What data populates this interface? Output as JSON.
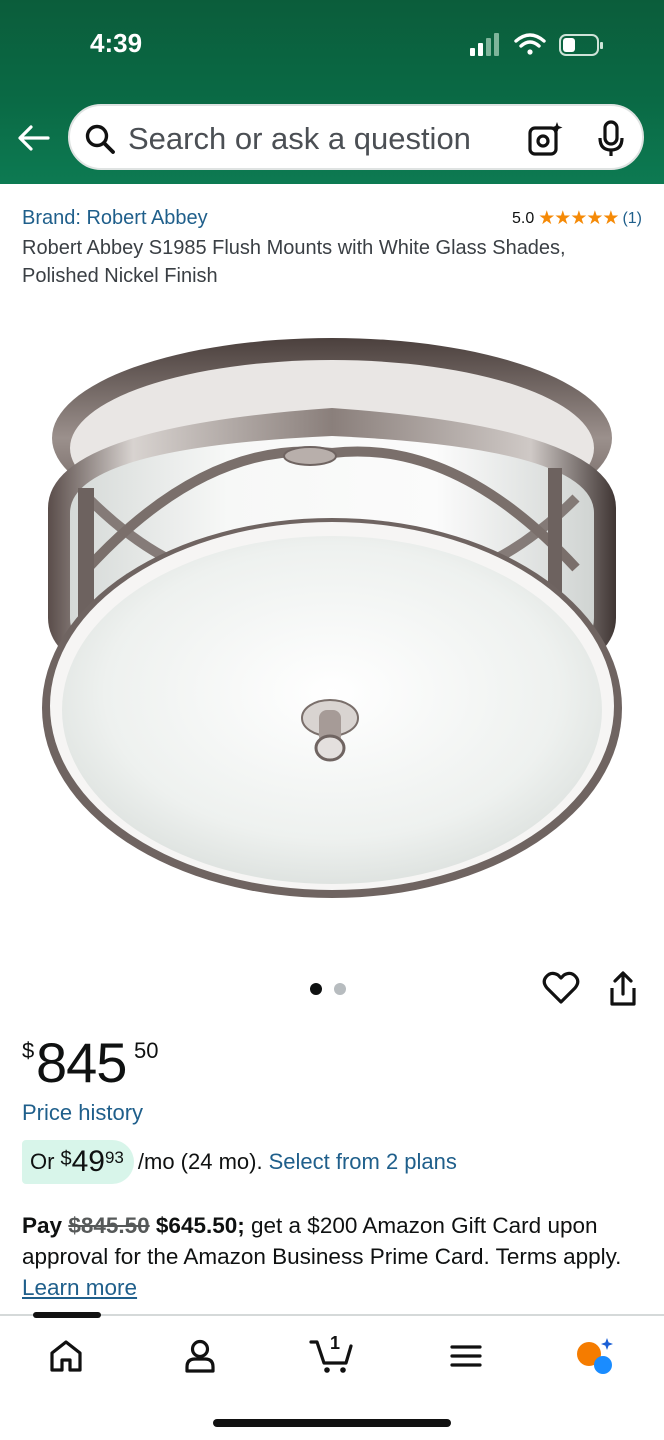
{
  "status_bar": {
    "time": "4:39"
  },
  "search": {
    "placeholder": "Search or ask a question"
  },
  "product": {
    "brand": "Brand: Robert Abbey",
    "rating_value": "5.0",
    "stars": "★★★★★",
    "rating_count": "(1)",
    "title": "Robert Abbey S1985 Flush Mounts with White Glass Shades, Polished Nickel Finish",
    "image_index": 1,
    "image_count": 2
  },
  "price": {
    "symbol": "$",
    "whole": "845",
    "fraction": "50",
    "history_link": "Price history"
  },
  "installment": {
    "prefix": "Or",
    "symbol": "$",
    "whole": "49",
    "fraction": "93",
    "term": "/mo (24 mo).",
    "link": "Select from 2 plans"
  },
  "promo": {
    "pay_label": "Pay",
    "original_price": "$845.50",
    "promo_price": "$645.50;",
    "text": "get a $200 Amazon Gift Card upon approval for the Amazon Business Prime Card. Terms apply.",
    "link": "Learn more"
  },
  "bottom_nav": {
    "items": [
      "home-icon",
      "account-icon",
      "cart-icon",
      "menu-icon",
      "rufus-icon"
    ],
    "cart_count": "1",
    "active_index": 0
  },
  "colors": {
    "header_green": "#0b5d3b",
    "link_blue": "#1f5f8b",
    "star_orange": "#f58a07",
    "installment_bg": "#d8f5ea",
    "assistant_orange": "#f57c00",
    "assistant_blue": "#1a8cff"
  }
}
